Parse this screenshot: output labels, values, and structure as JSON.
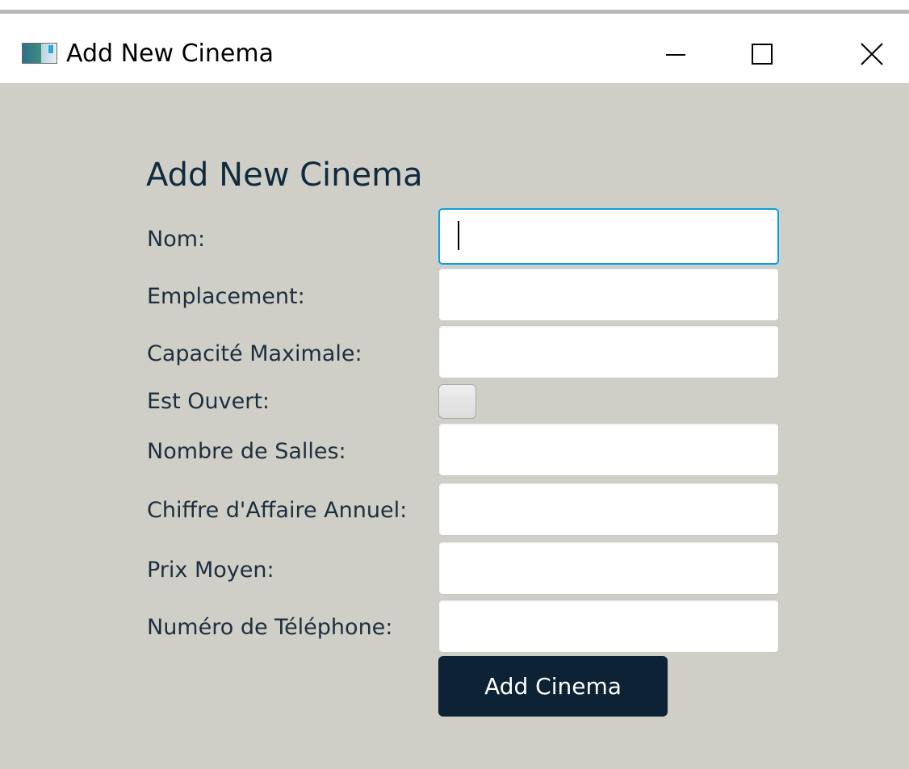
{
  "window": {
    "title": "Add New Cinema",
    "icon": "app-window-icon"
  },
  "controls": {
    "minimize": "minimize-icon",
    "maximize": "maximize-icon",
    "close": "close-icon"
  },
  "form": {
    "heading": "Add New Cinema",
    "fields": {
      "nom": {
        "label": "Nom:",
        "value": ""
      },
      "emplacement": {
        "label": "Emplacement:",
        "value": ""
      },
      "capacite": {
        "label": "Capacité Maximale:",
        "value": ""
      },
      "est_ouvert": {
        "label": "Est Ouvert:",
        "checked": false
      },
      "salles": {
        "label": "Nombre de Salles:",
        "value": ""
      },
      "chiffre": {
        "label": "Chiffre d'Affaire Annuel:",
        "value": ""
      },
      "prix": {
        "label": "Prix Moyen:",
        "value": ""
      },
      "telephone": {
        "label": "Numéro de Téléphone:",
        "value": ""
      }
    },
    "submit_label": "Add Cinema"
  },
  "colors": {
    "background": "#d0cfc7",
    "button": "#0e2236",
    "focus": "#1b9ad6"
  }
}
